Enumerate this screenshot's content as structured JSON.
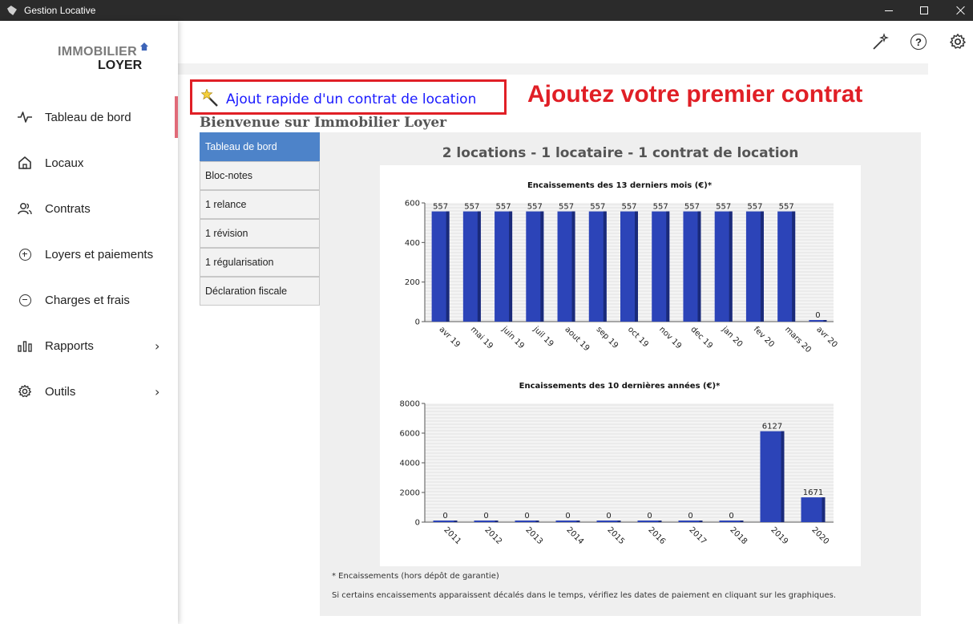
{
  "window": {
    "title": "Gestion Locative"
  },
  "logo": {
    "line1": "IMMOBILIER",
    "line2": "LOYER"
  },
  "sidebar": {
    "items": [
      {
        "label": "Tableau de bord",
        "icon": "activity-icon",
        "active": true
      },
      {
        "label": "Locaux",
        "icon": "home-icon"
      },
      {
        "label": "Contrats",
        "icon": "users-icon"
      },
      {
        "label": "Loyers et paiements",
        "icon": "plus-circle-icon"
      },
      {
        "label": "Charges et frais",
        "icon": "minus-circle-icon"
      },
      {
        "label": "Rapports",
        "icon": "bar-chart-icon",
        "chevron": "›"
      },
      {
        "label": "Outils",
        "icon": "gear-icon",
        "chevron": "›"
      }
    ]
  },
  "header": {
    "icons": [
      "magic-wand-icon",
      "help-icon",
      "gear-icon"
    ],
    "help_glyph": "?"
  },
  "quick_add": {
    "label": "Ajout rapide d'un contrat de location",
    "icon": "magic-wand-icon"
  },
  "annotation": "Ajoutez votre premier contrat",
  "welcome": "Bienvenue sur Immobilier Loyer",
  "tabs": [
    {
      "label": "Tableau de bord",
      "active": true
    },
    {
      "label": "Bloc-notes"
    },
    {
      "label": "1 relance"
    },
    {
      "label": "1 révision"
    },
    {
      "label": "1 régularisation"
    },
    {
      "label": "Déclaration fiscale"
    }
  ],
  "summary": "2 locations - 1 locataire - 1 contrat de location",
  "colors": {
    "bar": "#2c44b8",
    "bar_side": "#1a2a7a",
    "accent_red": "#e01f26",
    "tab_active": "#4d83c9"
  },
  "chart_data": [
    {
      "type": "bar",
      "title": "Encaissements des 13 derniers mois (€)*",
      "categories": [
        "avr 19",
        "mai 19",
        "juin 19",
        "juil 19",
        "aout 19",
        "sep 19",
        "oct 19",
        "nov 19",
        "dec 19",
        "jan 20",
        "fev 20",
        "mars 20",
        "avr 20"
      ],
      "values": [
        557,
        557,
        557,
        557,
        557,
        557,
        557,
        557,
        557,
        557,
        557,
        557,
        0
      ],
      "yticks": [
        0,
        200,
        400,
        600
      ],
      "ylim": [
        0,
        600
      ],
      "grid": true
    },
    {
      "type": "bar",
      "title": "Encaissements des 10 dernières années (€)*",
      "categories": [
        "2011",
        "2012",
        "2013",
        "2014",
        "2015",
        "2016",
        "2017",
        "2018",
        "2019",
        "2020"
      ],
      "values": [
        0,
        0,
        0,
        0,
        0,
        0,
        0,
        0,
        6127,
        1671
      ],
      "yticks": [
        0,
        2000,
        4000,
        6000,
        8000
      ],
      "ylim": [
        0,
        8000
      ],
      "grid": true
    }
  ],
  "footnotes": [
    "* Encaissements (hors dépôt de garantie)",
    "Si certains encaissements apparaissent décalés dans le temps, vérifiez les dates de paiement en cliquant sur les graphiques."
  ]
}
